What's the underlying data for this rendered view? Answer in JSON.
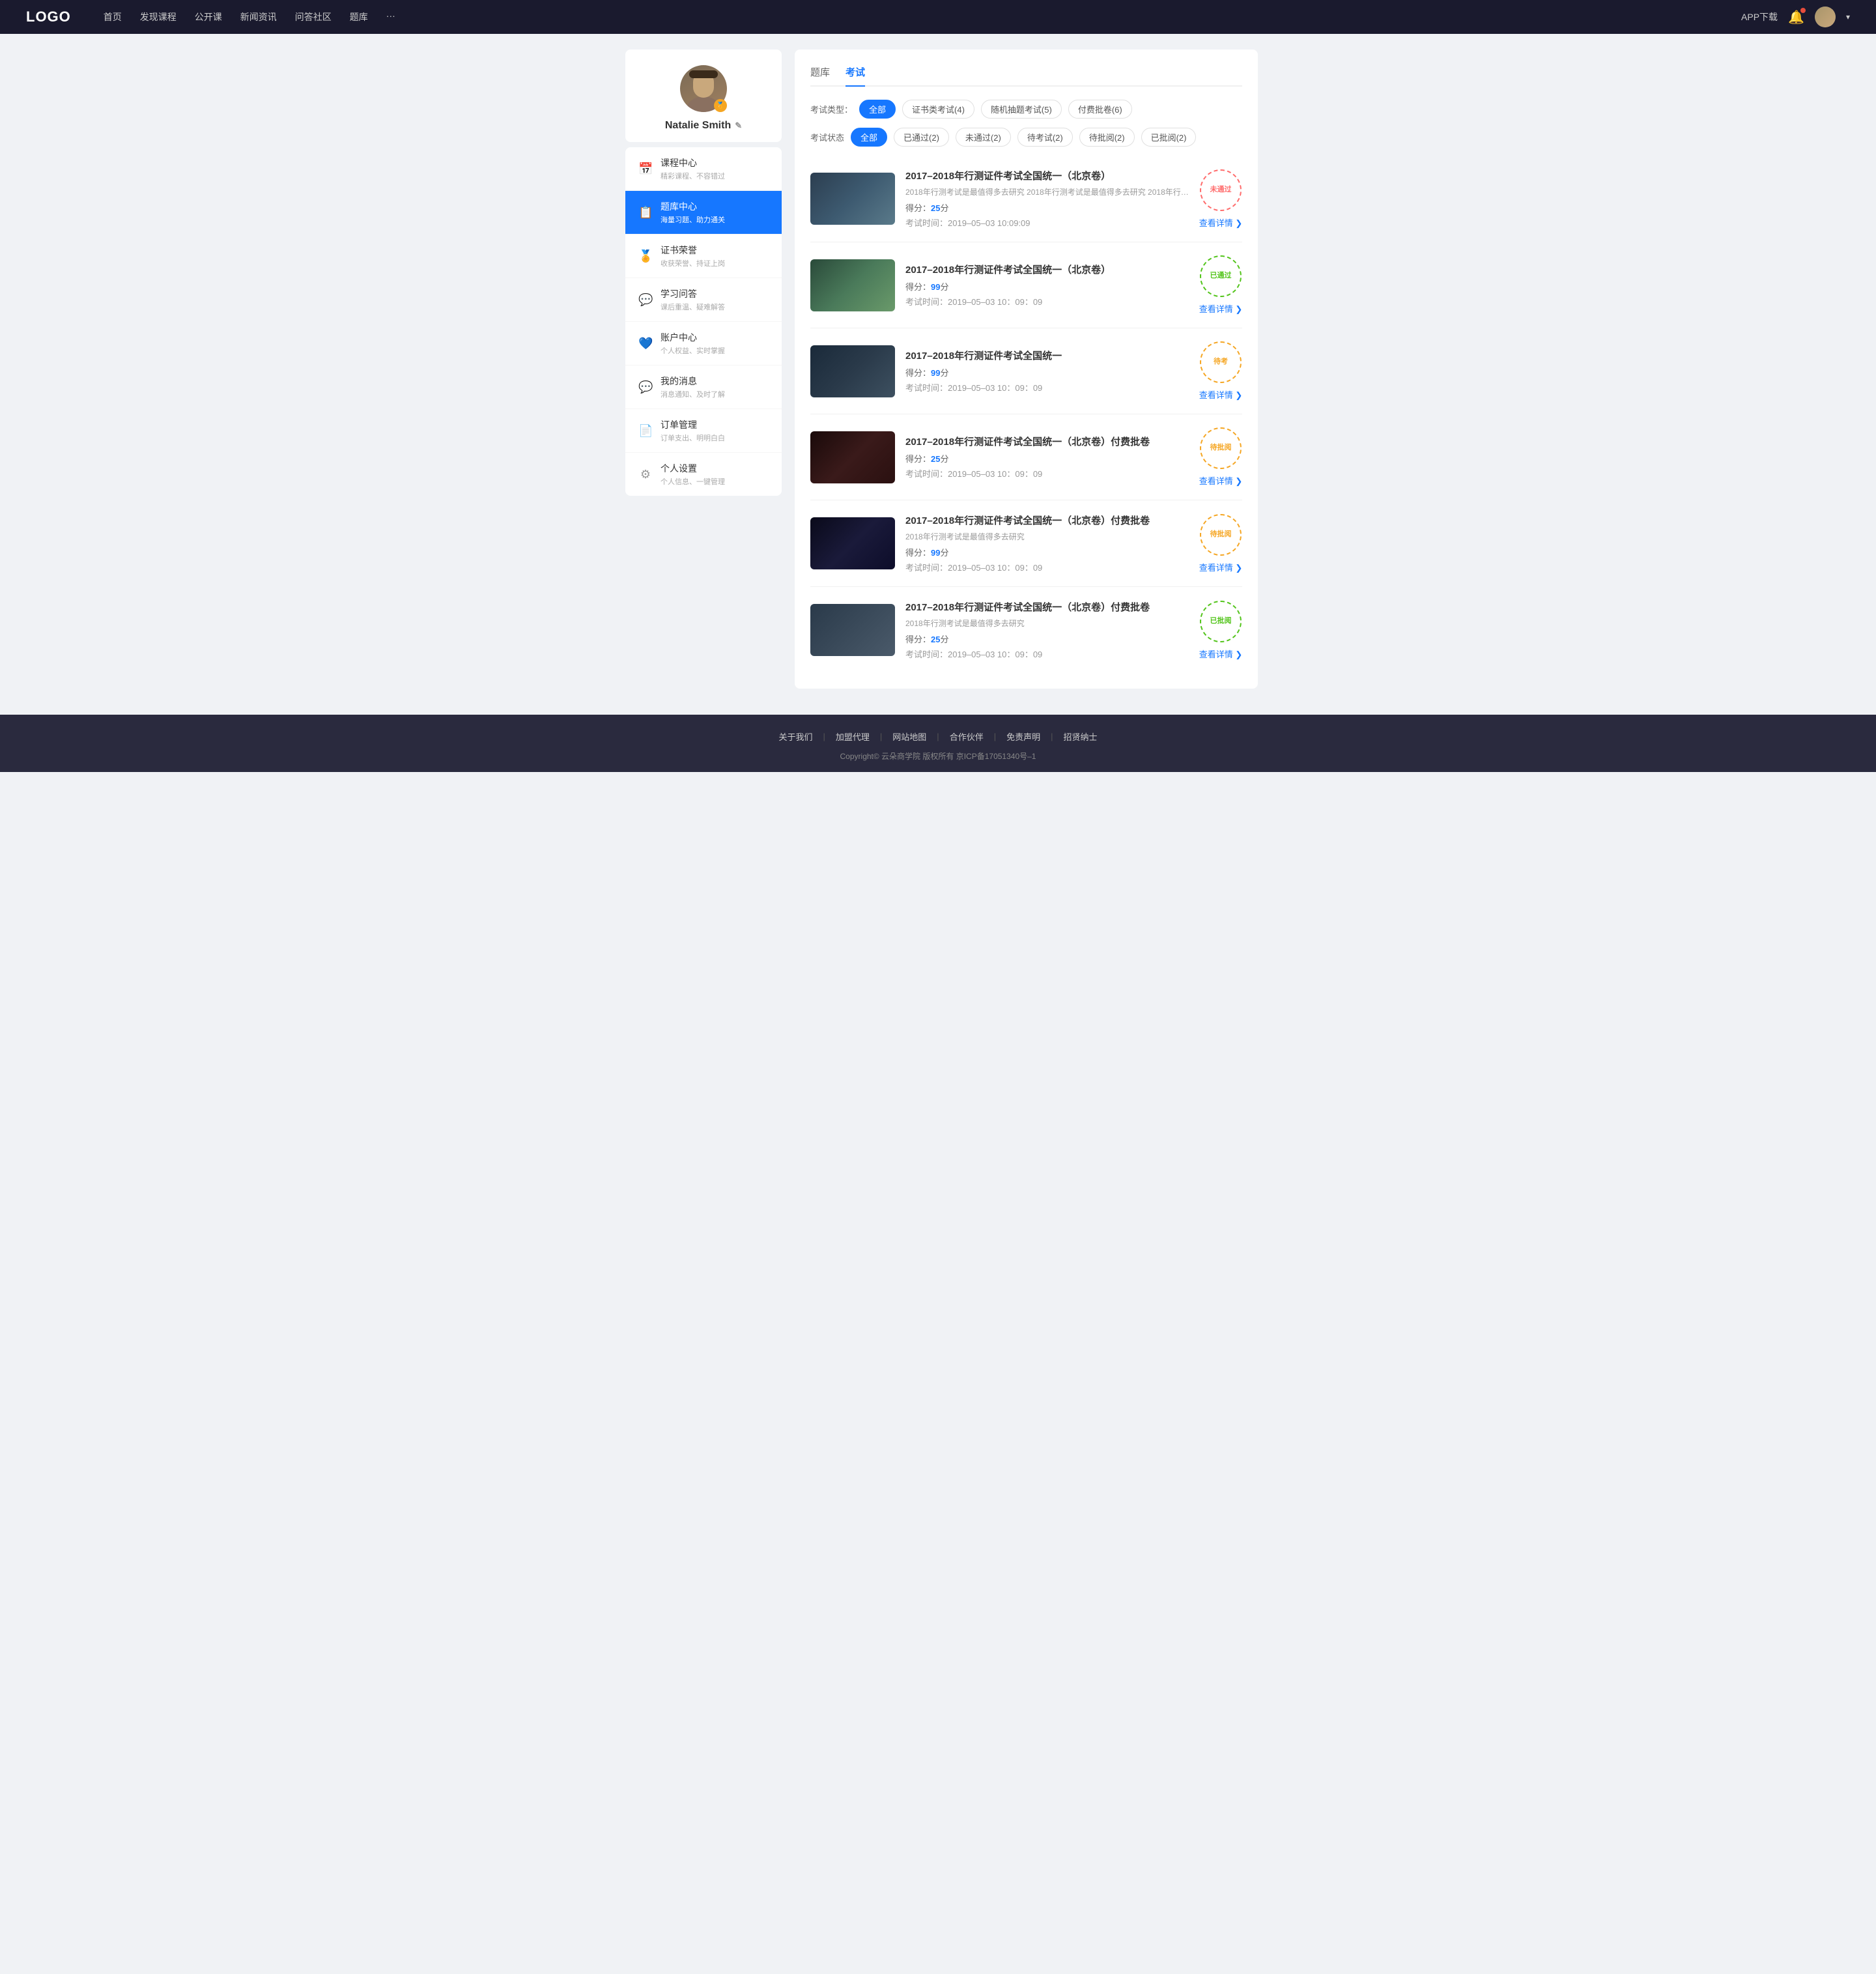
{
  "nav": {
    "logo": "LOGO",
    "links": [
      "首页",
      "发现课程",
      "公开课",
      "新闻资讯",
      "问答社区",
      "题库",
      "···"
    ],
    "app_download": "APP下载",
    "chevron": "▾"
  },
  "sidebar": {
    "username": "Natalie Smith",
    "edit_icon": "✎",
    "badge_icon": "🏅",
    "menu_items": [
      {
        "label": "课程中心",
        "sub": "精彩课程、不容错过",
        "icon": "📅"
      },
      {
        "label": "题库中心",
        "sub": "海量习题、助力通关",
        "icon": "📋",
        "active": true
      },
      {
        "label": "证书荣誉",
        "sub": "收获荣誉、持证上岗",
        "icon": "🏅"
      },
      {
        "label": "学习问答",
        "sub": "课后重温、疑难解答",
        "icon": "💬"
      },
      {
        "label": "账户中心",
        "sub": "个人权益、实时掌握",
        "icon": "💙"
      },
      {
        "label": "我的消息",
        "sub": "消息通知、及时了解",
        "icon": "💬"
      },
      {
        "label": "订单管理",
        "sub": "订单支出、明明白白",
        "icon": "📄"
      },
      {
        "label": "个人设置",
        "sub": "个人信息、一键管理",
        "icon": "⚙"
      }
    ]
  },
  "content": {
    "tabs": [
      "题库",
      "考试"
    ],
    "active_tab": "考试",
    "type_filter": {
      "label": "考试类型：",
      "options": [
        "全部",
        "证书类考试(4)",
        "随机抽题考试(5)",
        "付费批卷(6)"
      ],
      "active": "全部"
    },
    "status_filter": {
      "label": "考试状态",
      "options": [
        "全部",
        "已通过(2)",
        "未通过(2)",
        "待考试(2)",
        "待批阅(2)",
        "已批阅(2)"
      ],
      "active": "全部"
    },
    "exams": [
      {
        "title": "2017–2018年行测证件考试全国统一（北京卷）",
        "desc": "2018年行测考试是最值得多去研究 2018年行测考试是最值得多去研究 2018年行…",
        "score_label": "得分：",
        "score": "25",
        "score_unit": "分",
        "time_label": "考试时间：",
        "time": "2019–05–03  10:09:09",
        "status": "未通过",
        "status_type": "fail",
        "detail_label": "查看详情",
        "thumb_class": "thumb-1"
      },
      {
        "title": "2017–2018年行测证件考试全国统一（北京卷）",
        "desc": "",
        "score_label": "得分：",
        "score": "99",
        "score_unit": "分",
        "time_label": "考试时间：",
        "time": "2019–05–03  10：09：09",
        "status": "已通过",
        "status_type": "pass",
        "detail_label": "查看详情",
        "thumb_class": "thumb-2"
      },
      {
        "title": "2017–2018年行测证件考试全国统一",
        "desc": "",
        "score_label": "得分：",
        "score": "99",
        "score_unit": "分",
        "time_label": "考试时间：",
        "time": "2019–05–03  10：09：09",
        "status": "待考",
        "status_type": "pending",
        "detail_label": "查看详情",
        "thumb_class": "thumb-3"
      },
      {
        "title": "2017–2018年行测证件考试全国统一（北京卷）付费批卷",
        "desc": "",
        "score_label": "得分：",
        "score": "25",
        "score_unit": "分",
        "time_label": "考试时间：",
        "time": "2019–05–03  10：09：09",
        "status": "待批阅",
        "status_type": "pending",
        "detail_label": "查看详情",
        "thumb_class": "thumb-4"
      },
      {
        "title": "2017–2018年行测证件考试全国统一（北京卷）付费批卷",
        "desc": "2018年行测考试是最值得多去研究",
        "score_label": "得分：",
        "score": "99",
        "score_unit": "分",
        "time_label": "考试时间：",
        "time": "2019–05–03  10：09：09",
        "status": "待批阅",
        "status_type": "pending",
        "detail_label": "查看详情",
        "thumb_class": "thumb-5"
      },
      {
        "title": "2017–2018年行测证件考试全国统一（北京卷）付费批卷",
        "desc": "2018年行测考试是最值得多去研究",
        "score_label": "得分：",
        "score": "25",
        "score_unit": "分",
        "time_label": "考试时间：",
        "time": "2019–05–03  10：09：09",
        "status": "已批阅",
        "status_type": "reviewed",
        "detail_label": "查看详情",
        "thumb_class": "thumb-6"
      }
    ]
  },
  "footer": {
    "links": [
      "关于我们",
      "加盟代理",
      "网站地图",
      "合作伙伴",
      "免责声明",
      "招贤纳士"
    ],
    "copyright": "Copyright© 云朵商学院  版权所有    京ICP备17051340号–1"
  }
}
